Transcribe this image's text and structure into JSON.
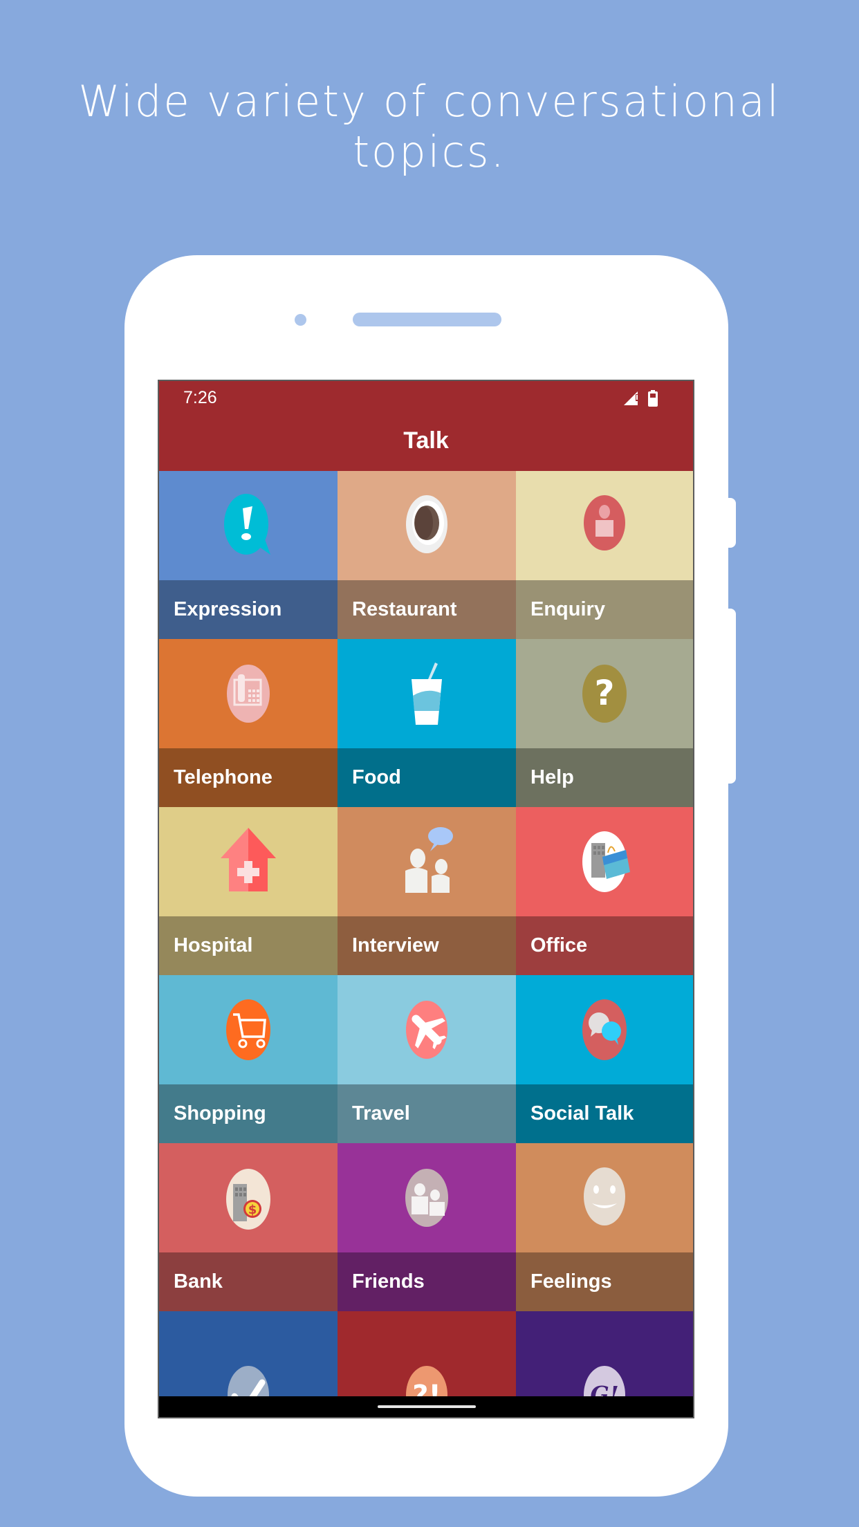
{
  "headline": "Wide variety of conversational topics.",
  "status_bar": {
    "time": "7:26",
    "icons": [
      "signal-no-data-icon",
      "battery-icon"
    ]
  },
  "app": {
    "title": "Talk",
    "accent_color": "#9e2a2e"
  },
  "topics": [
    {
      "label": "Expression",
      "icon": "speech-bubble-exclamation-icon",
      "bg": "#5e8bcf",
      "band": "#3f5e8c"
    },
    {
      "label": "Restaurant",
      "icon": "coffee-cup-icon",
      "bg": "#dfa987",
      "band": "#93725b"
    },
    {
      "label": "Enquiry",
      "icon": "person-icon",
      "bg": "#e8ddad",
      "band": "#9a9274"
    },
    {
      "label": "Telephone",
      "icon": "telephone-icon",
      "bg": "#dc7533",
      "band": "#904f22"
    },
    {
      "label": "Food",
      "icon": "drink-cup-icon",
      "bg": "#00a9d5",
      "band": "#016f8b"
    },
    {
      "label": "Help",
      "icon": "question-mark-icon",
      "bg": "#a6aa91",
      "band": "#6d715f"
    },
    {
      "label": "Hospital",
      "icon": "hospital-icon",
      "bg": "#dfcd88",
      "band": "#95885b"
    },
    {
      "label": "Interview",
      "icon": "interview-people-icon",
      "bg": "#d08b5e",
      "band": "#8e5e3f"
    },
    {
      "label": "Office",
      "icon": "office-briefcase-icon",
      "bg": "#ec5f5f",
      "band": "#9d3e3e"
    },
    {
      "label": "Shopping",
      "icon": "shopping-cart-icon",
      "bg": "#5fb9d3",
      "band": "#437b8b"
    },
    {
      "label": "Travel",
      "icon": "airplane-icon",
      "bg": "#8acbdf",
      "band": "#5d8795"
    },
    {
      "label": "Social Talk",
      "icon": "chat-bubbles-icon",
      "bg": "#01abd7",
      "band": "#00708d"
    },
    {
      "label": "Bank",
      "icon": "bank-coin-icon",
      "bg": "#d45f5f",
      "band": "#8c3f3f"
    },
    {
      "label": "Friends",
      "icon": "friends-icon",
      "bg": "#983298",
      "band": "#622064"
    },
    {
      "label": "Feelings",
      "icon": "smiley-face-icon",
      "bg": "#d08c5c",
      "band": "#8b5d3e"
    },
    {
      "label": "",
      "icon": "checkmark-icon",
      "bg": "#2c5ba0",
      "band": "#2c5ba0"
    },
    {
      "label": "",
      "icon": "interrobang-icon",
      "bg": "#a0292d",
      "band": "#a0292d"
    },
    {
      "label": "",
      "icon": "g-exclamation-icon",
      "bg": "#432077",
      "band": "#432077"
    }
  ]
}
